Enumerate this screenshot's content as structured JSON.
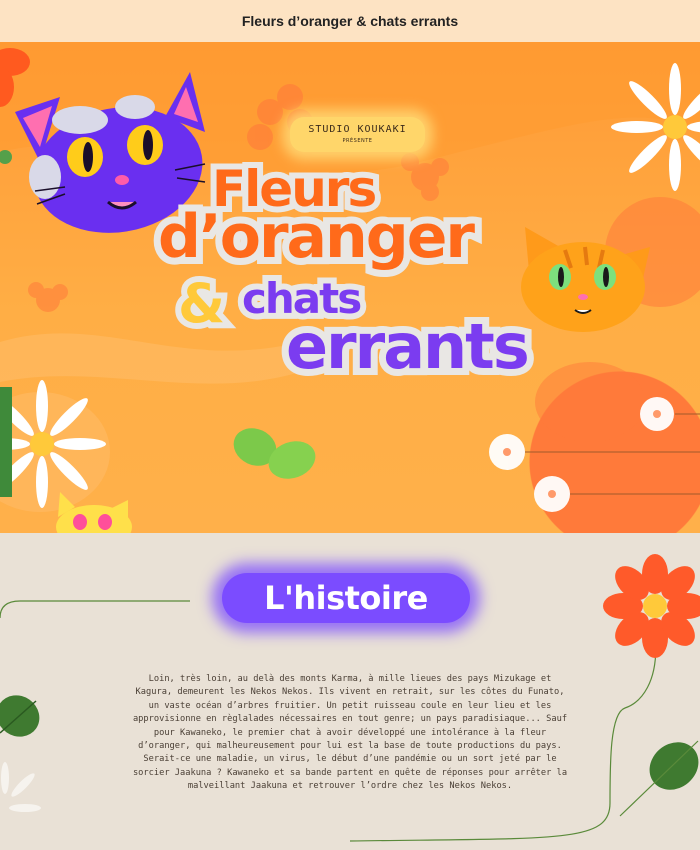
{
  "header": {
    "title": "Fleurs d’oranger & chats errants"
  },
  "hero": {
    "studio_name": "STUDIO KOUKAKI",
    "studio_sub": "PRÉSENTE",
    "logo": {
      "line1": "Fleurs",
      "line2": "d’oranger",
      "ampersand": "&",
      "line3": "chats",
      "line4": "errants"
    }
  },
  "story_section": {
    "heading": "L'histoire",
    "text": "Loin, très loin, au delà des monts Karma, à mille lieues des pays Mizukage et Kagura, demeurent les Nekos Nekos. Ils vivent en retrait, sur les côtes du Funato, un vaste océan d’arbres fruitier. Un petit ruisseau coule en leur lieu et les approvisionne en règlalades nécessaires en tout genre; un pays paradisiaque... Sauf pour Kawaneko, le premier chat à avoir développé une intolérance à la fleur d’oranger, qui malheureusement pour lui est la base de toute productions du pays. Serait-ce une maladie, un virus, le début d’une pandémie ou un sort jeté par le sorcier Jaakuna ? Kawaneko et sa bande partent en quête de réponses pour arrêter la malveillant Jaakuna et retrouver l’ordre chez les Nekos Nekos."
  },
  "colors": {
    "orange": "#ff6a1a",
    "purple": "#7b3cf0",
    "yellow": "#ffc93a",
    "cream": "#e9e1d6",
    "topbar": "#fde3c3"
  }
}
